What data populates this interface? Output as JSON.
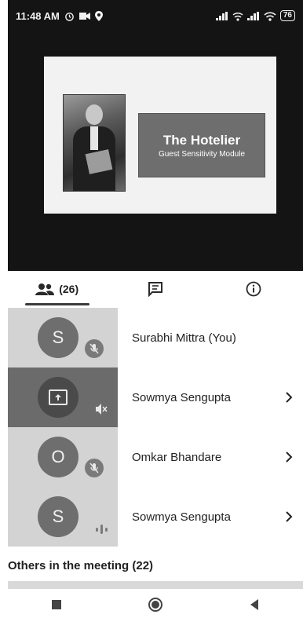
{
  "status_bar": {
    "time": "11:48 AM",
    "battery": "76",
    "icons": [
      "alarm-icon",
      "video-record-icon",
      "location-icon",
      "signal-icon",
      "wifi-icon",
      "battery-icon"
    ]
  },
  "slide": {
    "title": "The Hotelier",
    "subtitle": "Guest Sensitivity Module"
  },
  "tabs": [
    {
      "icon": "people-icon",
      "label": "(26)",
      "active": true
    },
    {
      "icon": "chat-icon",
      "label": "",
      "active": false
    },
    {
      "icon": "info-icon",
      "label": "",
      "active": false
    }
  ],
  "participants": [
    {
      "initial": "S",
      "name": "Surabhi Mittra (You)",
      "status": "muted"
    },
    {
      "initial": "",
      "name": "Sowmya Sengupta",
      "status": "presenting"
    },
    {
      "initial": "O",
      "name": "Omkar Bhandare",
      "status": "muted"
    },
    {
      "initial": "S",
      "name": "Sowmya Sengupta",
      "status": "speaking"
    }
  ],
  "others_label": "Others in the meeting (22)",
  "colors": {
    "video_bg": "#141414",
    "row_bg": "#d3d3d3",
    "presenting_bg": "#6b6b6b",
    "avatar": "#6e6e6e"
  }
}
